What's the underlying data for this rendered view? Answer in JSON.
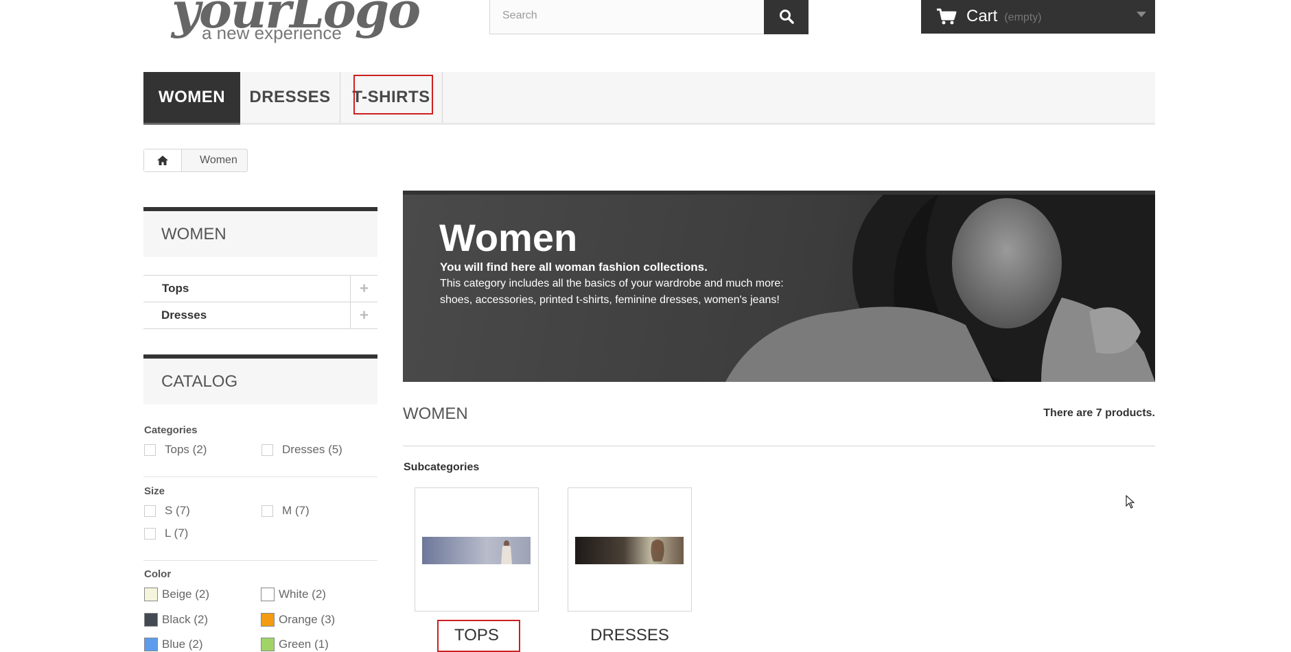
{
  "logo": {
    "text": "yourLogo",
    "tagline": "a new experience"
  },
  "search": {
    "placeholder": "Search",
    "button_icon": "search-icon"
  },
  "cart": {
    "label": "Cart",
    "status": "(empty)",
    "icon": "cart-icon"
  },
  "nav": {
    "items": [
      {
        "label": "WOMEN",
        "active": true
      },
      {
        "label": "DRESSES",
        "active": false
      },
      {
        "label": "T-SHIRTS",
        "active": false,
        "highlighted": true
      }
    ]
  },
  "breadcrumb": {
    "home_icon": "home-icon",
    "current": "Women"
  },
  "sidebar": {
    "women_block": {
      "title": "WOMEN",
      "items": [
        {
          "label": "Tops"
        },
        {
          "label": "Dresses"
        }
      ]
    },
    "catalog_block": {
      "title": "CATALOG",
      "categories": {
        "label": "Categories",
        "options": [
          "Tops (2)",
          "Dresses (5)"
        ]
      },
      "size": {
        "label": "Size",
        "options": [
          "S (7)",
          "M (7)",
          "L (7)"
        ]
      },
      "color": {
        "label": "Color",
        "options": [
          {
            "label": "Beige (2)",
            "color": "#f5f5dc"
          },
          {
            "label": "White (2)",
            "color": "#ffffff"
          },
          {
            "label": "Black (2)",
            "color": "#434A54"
          },
          {
            "label": "Orange (3)",
            "color": "#F39C11"
          },
          {
            "label": "Blue (2)",
            "color": "#5D9CEC"
          },
          {
            "label": "Green (1)",
            "color": "#A0D468"
          }
        ]
      }
    }
  },
  "banner": {
    "title": "Women",
    "lead": "You will find here all woman fashion collections.",
    "text": "This category includes all the basics of your wardrobe and much more: shoes, accessories, printed t-shirts, feminine dresses, women's jeans!"
  },
  "category": {
    "heading": "WOMEN",
    "count_text": "There are 7 products.",
    "subcategories_label": "Subcategories",
    "subcategories": [
      {
        "name": "TOPS",
        "highlighted": true
      },
      {
        "name": "DRESSES",
        "highlighted": false
      }
    ]
  },
  "colors": {
    "dark": "#333333",
    "highlight": "#cc1f1f",
    "panel": "#f6f6f6"
  }
}
